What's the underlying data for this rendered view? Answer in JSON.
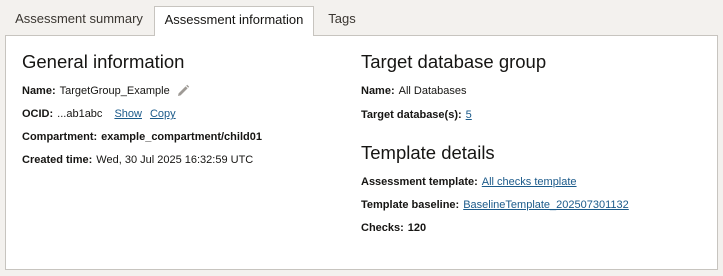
{
  "tabs": [
    {
      "label": "Assessment summary",
      "active": false
    },
    {
      "label": "Assessment information",
      "active": true
    },
    {
      "label": "Tags",
      "active": false
    }
  ],
  "general": {
    "heading": "General information",
    "name_label": "Name:",
    "name_value": "TargetGroup_Example",
    "edit_icon": "pencil-icon",
    "ocid_label": "OCID:",
    "ocid_value": "...ab1abc",
    "show_label": "Show",
    "copy_label": "Copy",
    "compartment_label": "Compartment:",
    "compartment_value": "example_compartment/child01",
    "created_label": "Created time:",
    "created_value": "Wed, 30 Jul 2025 16:32:59 UTC"
  },
  "target_group": {
    "heading": "Target database group",
    "name_label": "Name:",
    "name_value": "All Databases",
    "targets_label": "Target database(s):",
    "targets_value": "5"
  },
  "template": {
    "heading": "Template details",
    "assessment_label": "Assessment template:",
    "assessment_value": "All checks template",
    "baseline_label": "Template baseline:",
    "baseline_value": "BaselineTemplate_20250730113​2",
    "checks_label": "Checks:",
    "checks_value": "120"
  },
  "colors": {
    "link": "#1b5a8a",
    "background": "#f3f1ee",
    "panel": "#ffffff",
    "border": "#c7c4bf"
  }
}
